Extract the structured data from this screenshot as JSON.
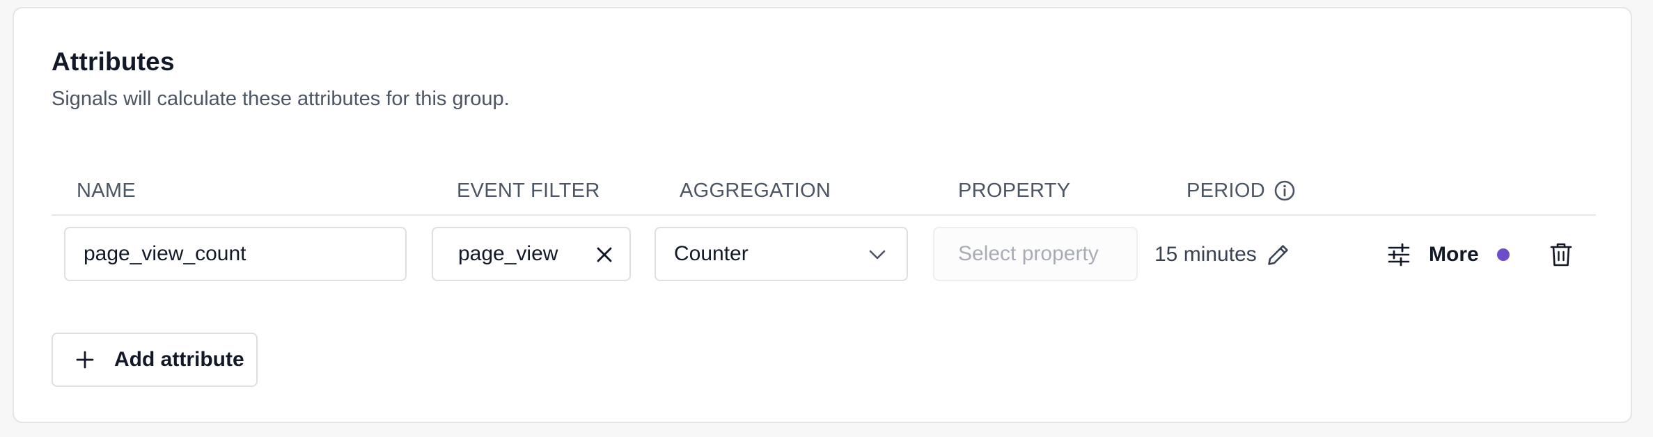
{
  "section": {
    "title": "Attributes",
    "subtitle": "Signals will calculate these attributes for this group."
  },
  "table": {
    "headers": {
      "name": "NAME",
      "event_filter": "EVENT FILTER",
      "aggregation": "AGGREGATION",
      "property": "PROPERTY",
      "period": "PERIOD"
    },
    "row": {
      "name_value": "page_view_count",
      "event_filter_value": "page_view",
      "aggregation_value": "Counter",
      "property_placeholder": "Select property",
      "period_value": "15 minutes",
      "more_label": "More"
    }
  },
  "actions": {
    "add_attribute_label": "Add attribute"
  },
  "colors": {
    "accent_dot": "#6b4fc8",
    "border": "#dcdfe4",
    "text_primary": "#111827",
    "text_secondary": "#4b5563"
  },
  "icons": {
    "period_info": "info-icon",
    "period_edit": "pencil-icon",
    "event_filter_clear": "close-icon",
    "aggregation_dropdown": "chevron-down-icon",
    "more_settings": "sliders-icon",
    "delete": "trash-icon",
    "add": "plus-icon"
  }
}
